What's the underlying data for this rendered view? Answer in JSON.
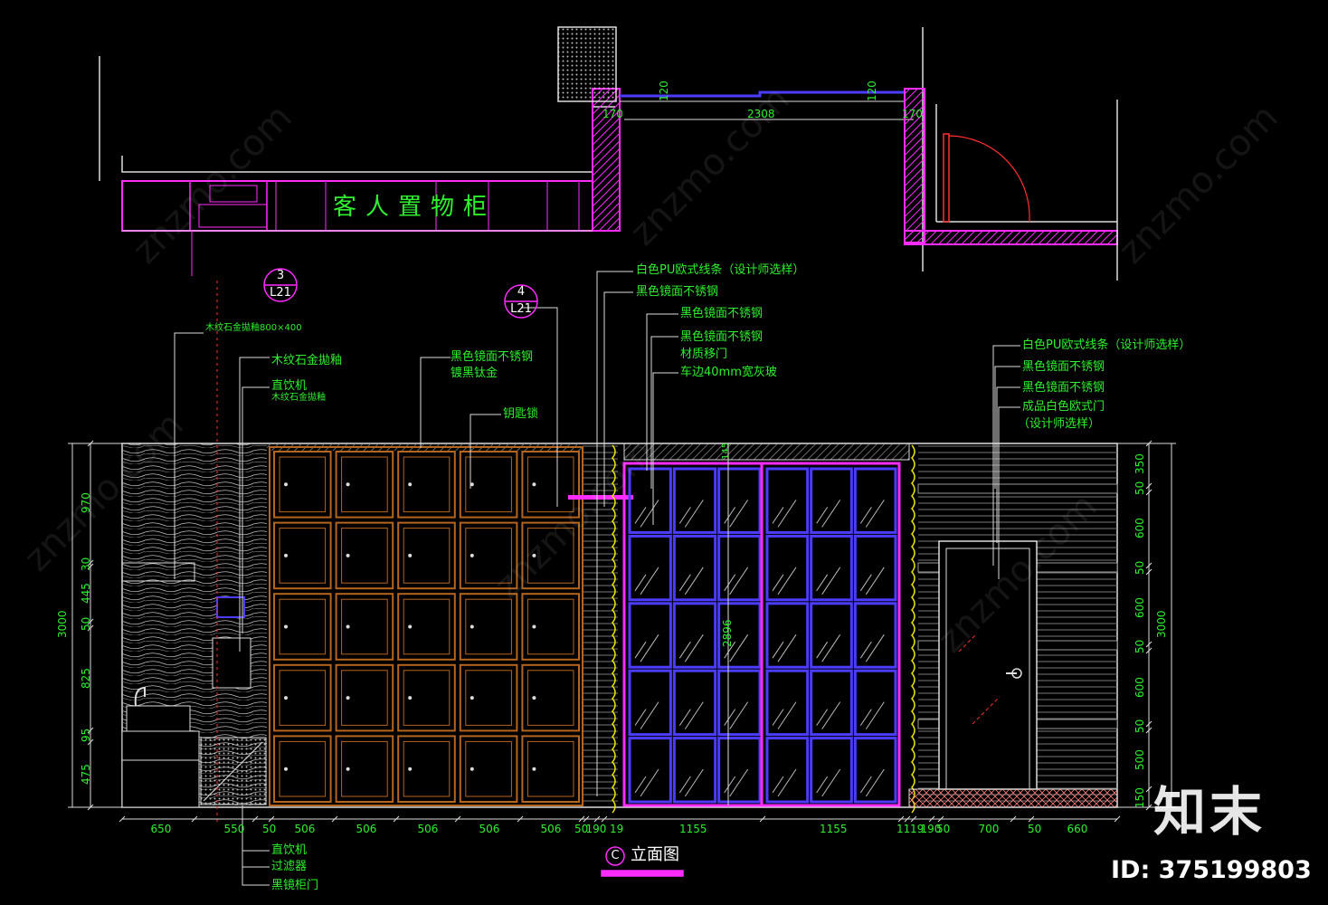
{
  "colors": {
    "line": "#e8e8e8",
    "magenta": "#ff2bff",
    "green": "#2ef02e",
    "brown": "#b5651d",
    "blue": "#4b3cff",
    "yellow": "#e6e600",
    "red": "#ff3030"
  },
  "plan": {
    "cabinet_label": "客人置物柜",
    "dims": [
      "170",
      "120",
      "2308",
      "120",
      "170"
    ]
  },
  "refs": [
    {
      "num": "3",
      "sheet": "L21"
    },
    {
      "num": "4",
      "sheet": "L21"
    }
  ],
  "labels": {
    "stone_size": "木纹石金拋釉800×400",
    "stone_finish": "木纹石金拋釉",
    "water_machine": "直饮机",
    "stone_finish2": "木纹石金拋釉",
    "black_steel": "黑色镜面不锈钢",
    "titanium": "镀黑钛金",
    "key_lock": "钥匙锁",
    "pu_line": "白色PU欧式线条（设计师选样）",
    "black_steel2": "黑色镜面不锈钢",
    "black_steel3": "黑色镜面不锈钢",
    "black_steel4": "黑色镜面不锈钢",
    "sliding_door": "材质移门",
    "glass": "车边40mm宽灰玻",
    "pu_line_right": "白色PU欧式线条（设计师选样）",
    "black_steel_r1": "黑色镜面不锈钢",
    "black_steel_r2": "黑色镜面不锈钢",
    "door": "成品白色欧式门",
    "door_note": "（设计师选样）",
    "water_machine_b": "直饮机",
    "filter": "过滤器",
    "black_mirror_door": "黑镜柜门"
  },
  "bottom_dims": [
    "650",
    "550",
    "50",
    "506",
    "506",
    "506",
    "506",
    "506",
    "50",
    "190",
    "19",
    "1155",
    "1155",
    "11",
    "19",
    "190",
    "50",
    "700",
    "50",
    "660"
  ],
  "left_dims": [
    "970",
    "30",
    "445",
    "50",
    "825",
    "95",
    "475"
  ],
  "left_total": "3000",
  "right_dims": [
    "350",
    "50",
    "600",
    "50",
    "600",
    "50",
    "600",
    "50",
    "500",
    "150"
  ],
  "right_total": "3000",
  "center_dim": "2896",
  "center_top_dim": "145",
  "title": "立面图",
  "title_ref": "C",
  "brand": "知末",
  "id_text": "ID: 375199803",
  "watermark": "znzmo.com"
}
